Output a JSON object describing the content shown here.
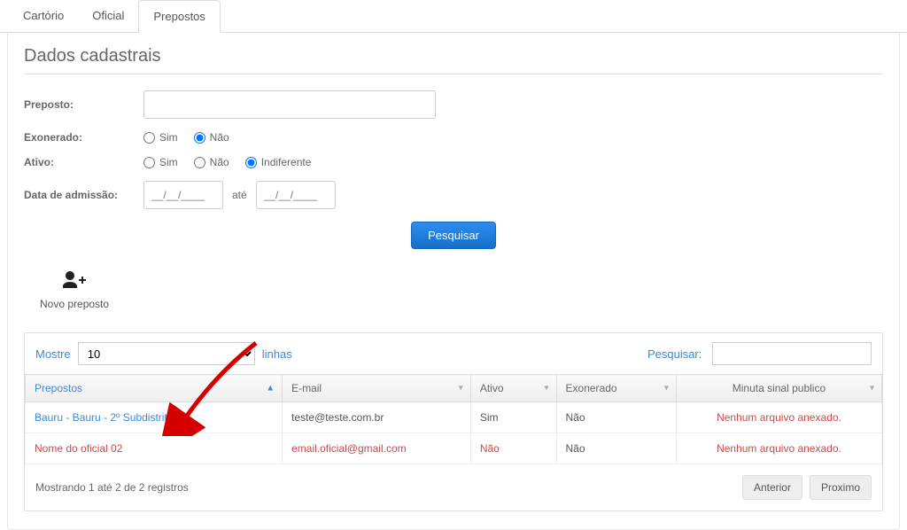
{
  "tabs": [
    {
      "label": "Cartório"
    },
    {
      "label": "Oficial"
    },
    {
      "label": "Prepostos"
    }
  ],
  "section_title": "Dados cadastrais",
  "form": {
    "preposto_label": "Preposto:",
    "exonerado_label": "Exonerado:",
    "exonerado_options": {
      "sim": "Sim",
      "nao": "Não"
    },
    "ativo_label": "Ativo:",
    "ativo_options": {
      "sim": "Sim",
      "nao": "Não",
      "indiferente": "Indiferente"
    },
    "data_admissao_label": "Data de admissão:",
    "date_placeholder": "__/__/____",
    "date_sep": "até",
    "pesquisar_btn": "Pesquisar"
  },
  "novo": {
    "label": "Novo preposto"
  },
  "table_controls": {
    "mostre_label": "Mostre",
    "mostre_value": "10",
    "linhas_label": "linhas",
    "pesquisar_label": "Pesquisar:"
  },
  "table": {
    "headers": {
      "prepostos": "Prepostos",
      "email": "E-mail",
      "ativo": "Ativo",
      "exonerado": "Exonerado",
      "minuta": "Minuta sinal publico"
    },
    "rows": [
      {
        "preposto": "Bauru - Bauru - 2º Subdistrito",
        "email": "teste@teste.com.br",
        "ativo": "Sim",
        "exonerado": "Não",
        "minuta": "Nenhum arquivo anexado."
      },
      {
        "preposto": "Nome do oficial 02",
        "email": "email.oficial@gmail.com",
        "ativo": "Não",
        "exonerado": "Não",
        "minuta": "Nenhum arquivo anexado."
      }
    ],
    "info": "Mostrando 1 até 2 de 2 registros",
    "prev": "Anterior",
    "next": "Proximo"
  }
}
